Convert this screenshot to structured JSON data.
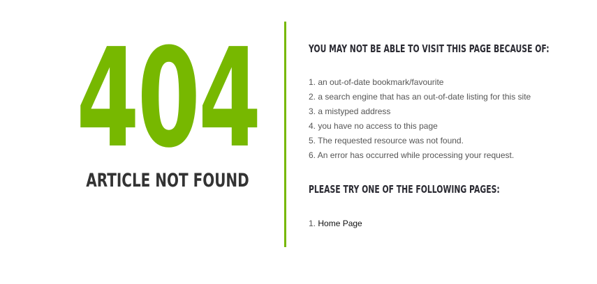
{
  "error": {
    "code": "404",
    "message": "ARTICLE NOT FOUND"
  },
  "reasons_section": {
    "heading": "YOU MAY NOT BE ABLE TO VISIT THIS PAGE BECAUSE OF:",
    "items": [
      {
        "num": "1.",
        "text": "an out-of-date bookmark/favourite"
      },
      {
        "num": "2.",
        "text": "a search engine that has an out-of-date listing for this site"
      },
      {
        "num": "3.",
        "text": "a mistyped address"
      },
      {
        "num": "4.",
        "text": "you have no access to this page"
      },
      {
        "num": "5.",
        "text": "The requested resource was not found."
      },
      {
        "num": "6.",
        "text": "An error has occurred while processing your request."
      }
    ]
  },
  "pages_section": {
    "heading": "PLEASE TRY ONE OF THE FOLLOWING PAGES:",
    "items": [
      {
        "num": "1.",
        "label": "Home Page"
      }
    ]
  },
  "colors": {
    "accent": "#77b800",
    "heading": "#2b2b33",
    "text": "#555555"
  }
}
